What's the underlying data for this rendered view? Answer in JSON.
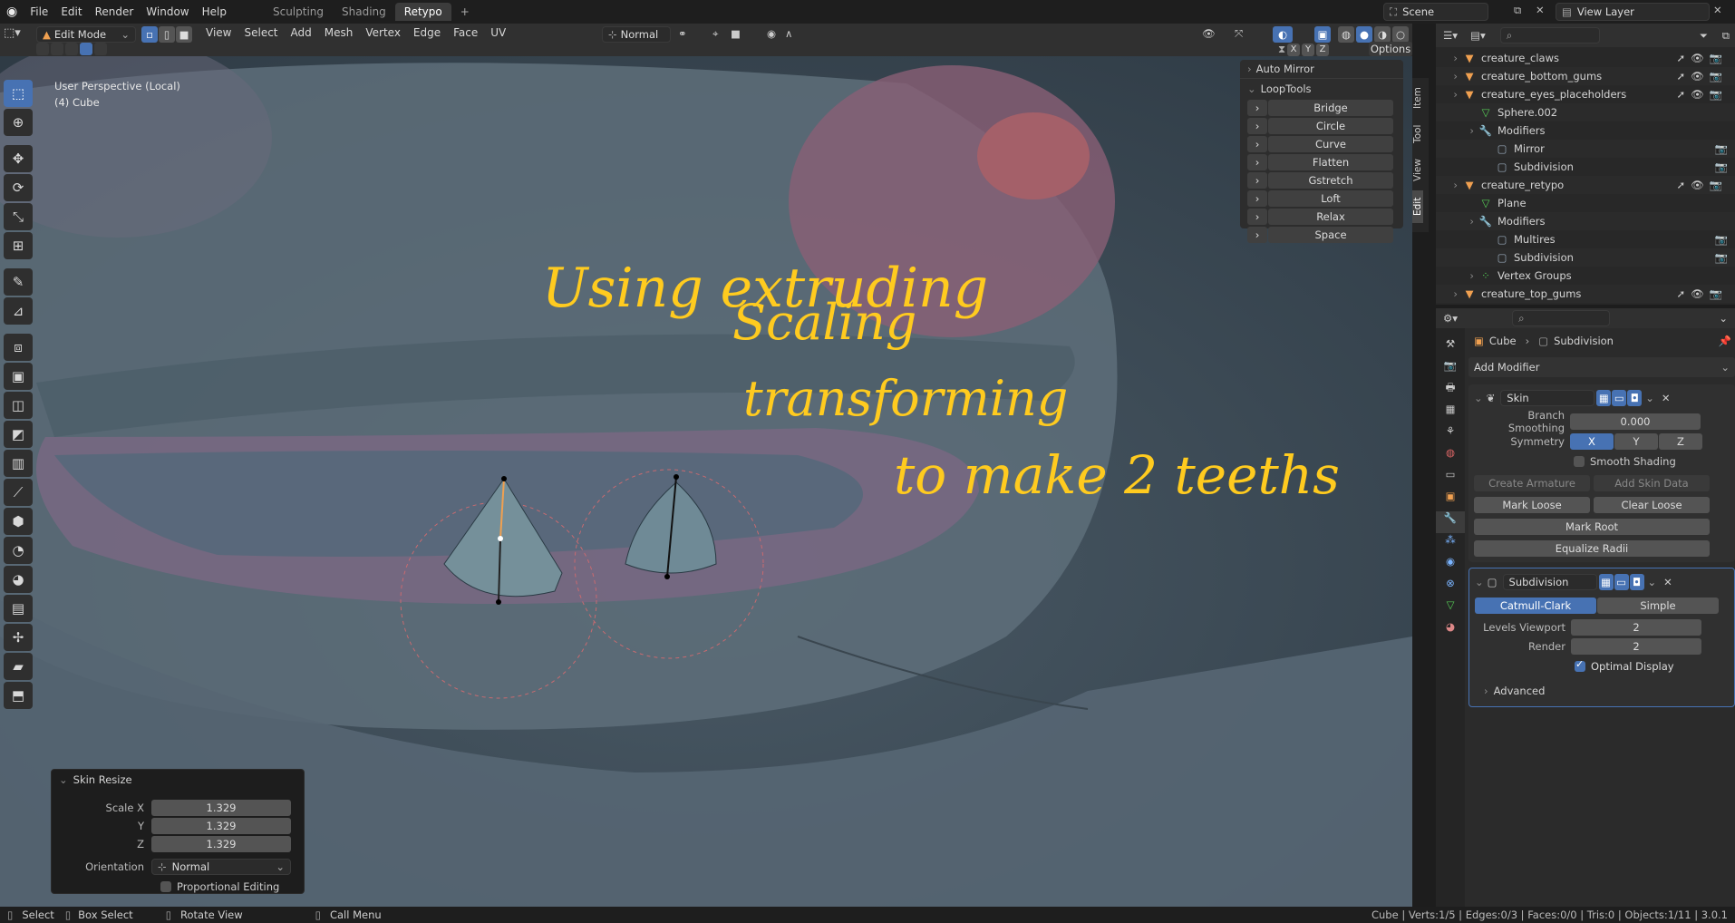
{
  "menu": [
    "File",
    "Edit",
    "Render",
    "Window",
    "Help"
  ],
  "workspaces": [
    {
      "label": "Sculpting",
      "active": false
    },
    {
      "label": "Shading",
      "active": false
    },
    {
      "label": "Retypo",
      "active": true
    }
  ],
  "scene": {
    "name": "Scene",
    "view_layer": "View Layer"
  },
  "viewport_header": {
    "mode": "Edit Mode",
    "menus": [
      "View",
      "Select",
      "Add",
      "Mesh",
      "Vertex",
      "Edge",
      "Face",
      "UV"
    ],
    "orientation": "Normal",
    "axes": [
      "X",
      "Y",
      "Z"
    ],
    "options_label": "Options"
  },
  "viewport_info": {
    "perspective": "User Perspective (Local)",
    "object": "(4) Cube"
  },
  "annotation": [
    "Using extruding",
    "Scaling",
    "transforming",
    "to make 2 teeths"
  ],
  "looptools": {
    "auto_mirror": "Auto Mirror",
    "title": "LoopTools",
    "items": [
      "Bridge",
      "Circle",
      "Curve",
      "Flatten",
      "Gstretch",
      "Loft",
      "Relax",
      "Space"
    ]
  },
  "sidebar_tabs": [
    "Item",
    "Tool",
    "View",
    "Edit"
  ],
  "last_operator": {
    "title": "Skin Resize",
    "scale_x_label": "Scale X",
    "y_label": "Y",
    "z_label": "Z",
    "scale_x": "1.329",
    "scale_y": "1.329",
    "scale_z": "1.329",
    "orientation_label": "Orientation",
    "orientation": "Normal",
    "proportional": "Proportional Editing"
  },
  "outliner": [
    {
      "indent": 1,
      "label": "creature_claws",
      "icon": "mesh"
    },
    {
      "indent": 1,
      "label": "creature_bottom_gums",
      "icon": "mesh"
    },
    {
      "indent": 1,
      "label": "creature_eyes_placeholders",
      "icon": "mesh"
    },
    {
      "indent": 2,
      "label": "Sphere.002",
      "icon": "data"
    },
    {
      "indent": 2,
      "label": "Modifiers",
      "icon": "wrench"
    },
    {
      "indent": 3,
      "label": "Mirror",
      "icon": "mod"
    },
    {
      "indent": 3,
      "label": "Subdivision",
      "icon": "mod"
    },
    {
      "indent": 1,
      "label": "creature_retypo",
      "icon": "mesh"
    },
    {
      "indent": 2,
      "label": "Plane",
      "icon": "data"
    },
    {
      "indent": 2,
      "label": "Modifiers",
      "icon": "wrench"
    },
    {
      "indent": 3,
      "label": "Multires",
      "icon": "mod"
    },
    {
      "indent": 3,
      "label": "Subdivision",
      "icon": "mod"
    },
    {
      "indent": 2,
      "label": "Vertex Groups",
      "icon": "group"
    },
    {
      "indent": 1,
      "label": "creature_top_gums",
      "icon": "mesh"
    }
  ],
  "properties": {
    "breadcrumb_object": "Cube",
    "breadcrumb_modifier": "Subdivision",
    "add_modifier": "Add Modifier",
    "skin": {
      "name": "Skin",
      "branch_smoothing_label": "Branch Smoothing",
      "branch_smoothing": "0.000",
      "symmetry_label": "Symmetry",
      "sym": [
        "X",
        "Y",
        "Z"
      ],
      "smooth_shading": "Smooth Shading",
      "create_armature": "Create Armature",
      "add_skin_data": "Add Skin Data",
      "mark_loose": "Mark Loose",
      "clear_loose": "Clear Loose",
      "mark_root": "Mark Root",
      "equalize_radii": "Equalize Radii"
    },
    "subdivision": {
      "name": "Subdivision",
      "catmull": "Catmull-Clark",
      "simple": "Simple",
      "levels_viewport_label": "Levels Viewport",
      "levels_viewport": "2",
      "render_label": "Render",
      "render": "2",
      "optimal_display": "Optimal Display",
      "advanced": "Advanced"
    }
  },
  "status": {
    "select": "Select",
    "box_select": "Box Select",
    "rotate_view": "Rotate View",
    "call_menu": "Call Menu",
    "stats": "Cube | Verts:1/5 | Edges:0/3 | Faces:0/0 | Tris:0 | Objects:1/11 | 3.0.1"
  }
}
